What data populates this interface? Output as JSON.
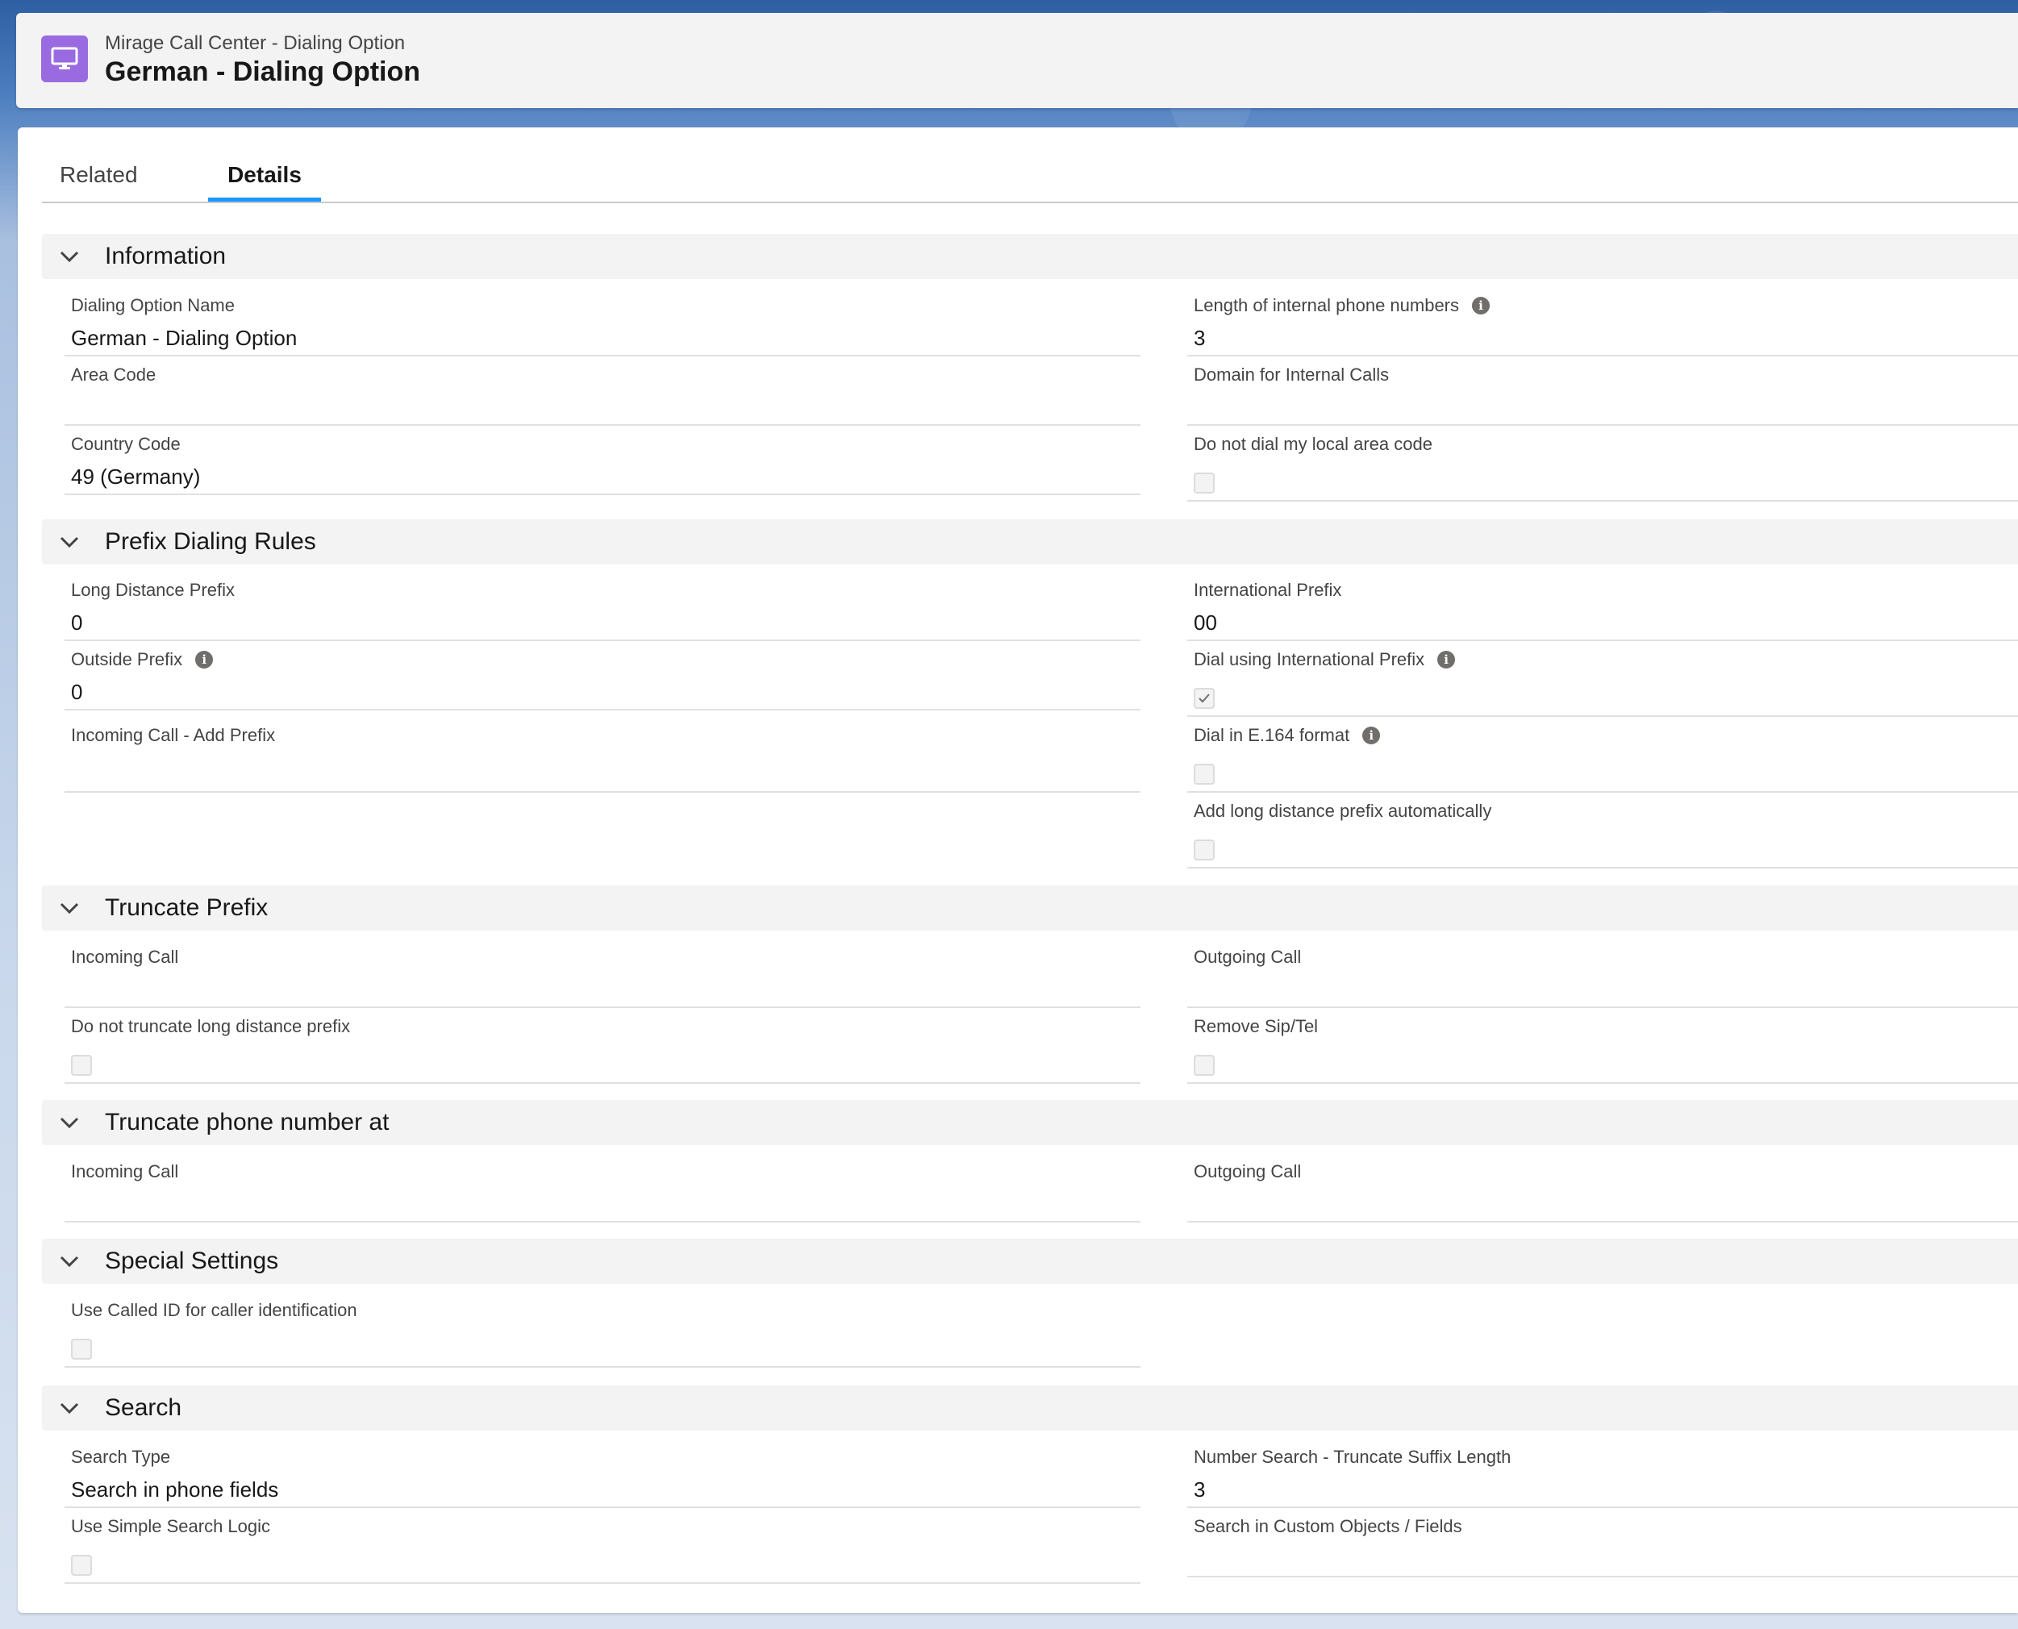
{
  "header": {
    "subtitle": "Mirage Call Center - Dialing Option",
    "title": "German - Dialing Option",
    "icon": "monitor-icon",
    "icon_color": "#9a6be0"
  },
  "tabs": [
    {
      "label": "Related",
      "active": false
    },
    {
      "label": "Details",
      "active": true
    }
  ],
  "sections": {
    "information": {
      "title": "Information",
      "dialing_option_name": {
        "label": "Dialing Option Name",
        "value": "German - Dialing Option"
      },
      "length_internal": {
        "label": "Length of internal phone numbers",
        "value": "3"
      },
      "area_code": {
        "label": "Area Code",
        "value": ""
      },
      "domain_internal": {
        "label": "Domain for Internal Calls",
        "value": ""
      },
      "country_code": {
        "label": "Country Code",
        "value": "49 (Germany)"
      },
      "do_not_dial_local": {
        "label": "Do not dial my local area code",
        "checked": false
      }
    },
    "prefix": {
      "title": "Prefix Dialing Rules",
      "long_distance_prefix": {
        "label": "Long Distance Prefix",
        "value": "0"
      },
      "international_prefix": {
        "label": "International Prefix",
        "value": "00"
      },
      "outside_prefix": {
        "label": "Outside Prefix",
        "value": "0"
      },
      "dial_international": {
        "label": "Dial using International Prefix",
        "checked": true
      },
      "incoming_add_prefix": {
        "label": "Incoming Call - Add Prefix",
        "value": ""
      },
      "dial_e164": {
        "label": "Dial in E.164 format",
        "checked": false
      },
      "add_long_distance": {
        "label": "Add long distance prefix automatically",
        "checked": false
      }
    },
    "truncate_prefix": {
      "title": "Truncate Prefix",
      "incoming_call": {
        "label": "Incoming Call",
        "value": ""
      },
      "outgoing_call": {
        "label": "Outgoing Call",
        "value": ""
      },
      "no_truncate_long": {
        "label": "Do not truncate long distance prefix",
        "checked": false
      },
      "remove_sip": {
        "label": "Remove Sip/Tel",
        "checked": false
      }
    },
    "truncate_number": {
      "title": "Truncate phone number at",
      "incoming_call": {
        "label": "Incoming Call",
        "value": ""
      },
      "outgoing_call": {
        "label": "Outgoing Call",
        "value": ""
      }
    },
    "special": {
      "title": "Special Settings",
      "use_called_id": {
        "label": "Use Called ID for caller identification",
        "checked": false
      }
    },
    "search": {
      "title": "Search",
      "search_type": {
        "label": "Search Type",
        "value": "Search in phone fields"
      },
      "truncate_suffix": {
        "label": "Number Search - Truncate Suffix Length",
        "value": "3"
      },
      "simple_logic": {
        "label": "Use Simple Search Logic",
        "checked": false
      },
      "custom_objects": {
        "label": "Search in Custom Objects / Fields",
        "value": ""
      }
    }
  }
}
